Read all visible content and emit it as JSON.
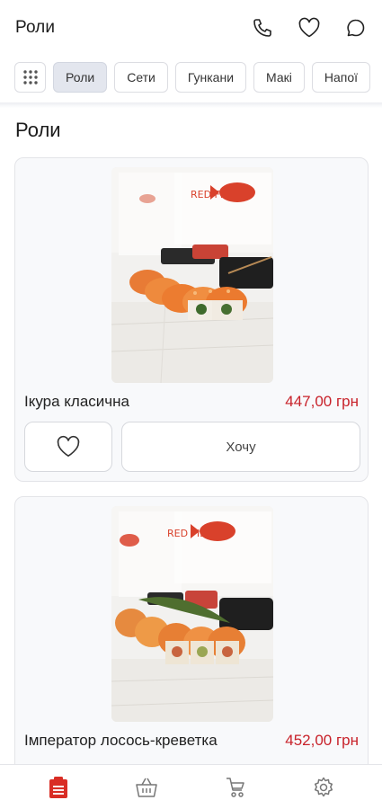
{
  "header": {
    "title": "Роли",
    "icons": [
      "phone-icon",
      "heart-icon",
      "chat-icon"
    ]
  },
  "categories": {
    "menu_icon": "grid-icon",
    "items": [
      {
        "label": "Роли",
        "active": true
      },
      {
        "label": "Сети",
        "active": false
      },
      {
        "label": "Гункани",
        "active": false
      },
      {
        "label": "Макі",
        "active": false
      },
      {
        "label": "Напої",
        "active": false
      }
    ]
  },
  "section": {
    "title": "Роли"
  },
  "products": [
    {
      "name": "Ікура класична",
      "price": "447,00 грн",
      "favorite_icon": "heart-icon",
      "action_label": "Хочу",
      "photo_watermark": "RED FISH"
    },
    {
      "name": "Імператор лосось-креветка",
      "price": "452,00 грн",
      "photo_watermark": "RED FISH"
    }
  ],
  "bottom_nav": {
    "items": [
      {
        "icon": "menu-list-icon",
        "active": true
      },
      {
        "icon": "basket-icon",
        "active": false
      },
      {
        "icon": "delivery-icon",
        "active": false
      },
      {
        "icon": "settings-icon",
        "active": false
      }
    ]
  },
  "colors": {
    "accent": "#c8222a",
    "price": "#c8222a",
    "chip_active": "#e3e6ee",
    "card_bg": "#f8f9fb"
  }
}
